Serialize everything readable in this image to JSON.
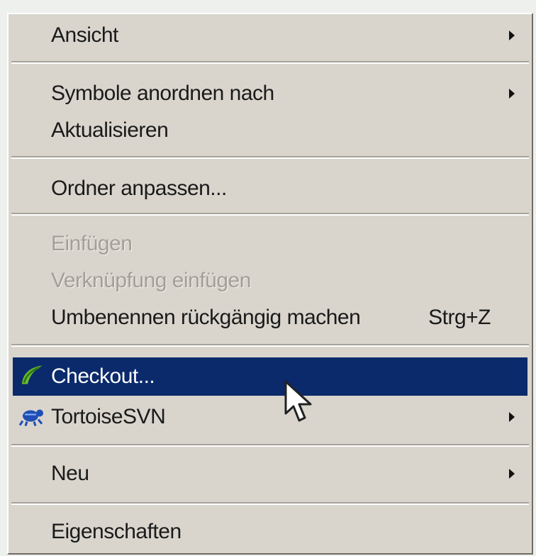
{
  "menu": {
    "items": [
      {
        "label": "Ansicht",
        "submenu": true,
        "enabled": true
      },
      {
        "label": "Symbole anordnen nach",
        "submenu": true,
        "enabled": true
      },
      {
        "label": "Aktualisieren",
        "enabled": true
      },
      {
        "label": "Ordner anpassen...",
        "enabled": true
      },
      {
        "label": "Einfügen",
        "enabled": false
      },
      {
        "label": "Verknüpfung einfügen",
        "enabled": false
      },
      {
        "label": "Umbenennen rückgängig machen",
        "shortcut": "Strg+Z",
        "enabled": true
      },
      {
        "label": "Checkout...",
        "icon": "checkout-icon",
        "highlighted": true,
        "enabled": true
      },
      {
        "label": "TortoiseSVN",
        "icon": "tortoisesvn-icon",
        "submenu": true,
        "enabled": true
      },
      {
        "label": "Neu",
        "submenu": true,
        "enabled": true
      },
      {
        "label": "Eigenschaften",
        "enabled": true
      }
    ]
  },
  "colors": {
    "menu_background": "#d9d5cd",
    "highlight": "#0a2a6b",
    "disabled_text": "#a39f98"
  }
}
